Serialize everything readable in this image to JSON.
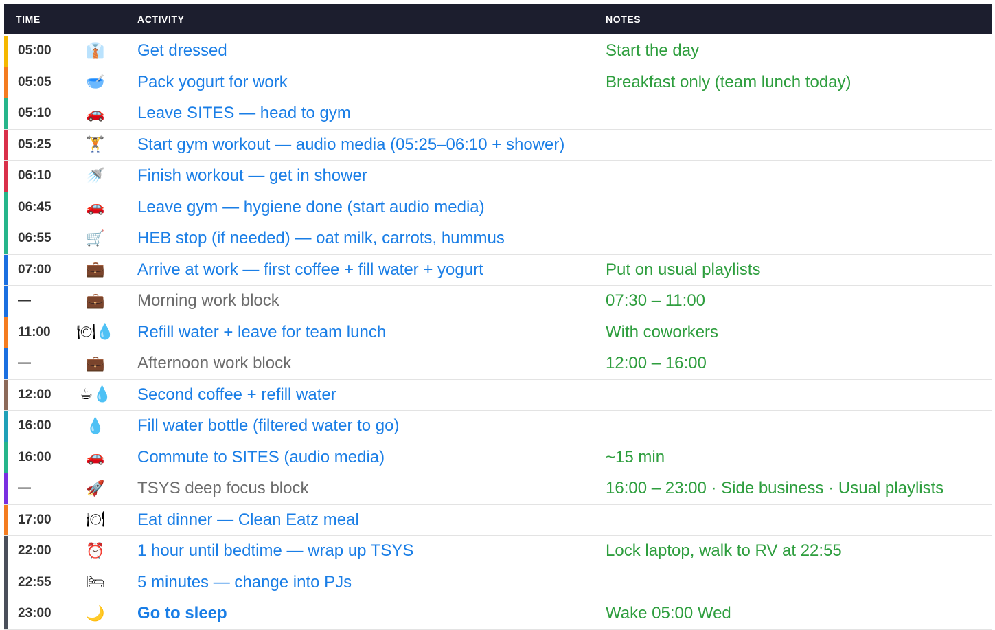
{
  "header": {
    "time": "TIME",
    "activity": "ACTIVITY",
    "notes": "NOTES"
  },
  "rows": [
    {
      "time": "05:00",
      "icon": "👔",
      "icon_name": "shirt-icon",
      "activity": "Get dressed",
      "notes": "Start the day",
      "color": "#f5b800"
    },
    {
      "time": "05:05",
      "icon": "🥣",
      "icon_name": "bowl-icon",
      "activity": "Pack yogurt for work",
      "notes": "Breakfast only (team lunch today)",
      "color": "#f47c20"
    },
    {
      "time": "05:10",
      "icon": "🚗",
      "icon_name": "car-icon",
      "activity": "Leave SITES — head to gym",
      "notes": "",
      "color": "#26b58a"
    },
    {
      "time": "05:25",
      "icon": "🏋",
      "icon_name": "weightlifter-icon",
      "activity": "Start gym workout — audio media (05:25–06:10 + shower)",
      "notes": "",
      "color": "#d9304a"
    },
    {
      "time": "06:10",
      "icon": "🚿",
      "icon_name": "shower-icon",
      "activity": "Finish workout — get in shower",
      "notes": "",
      "color": "#d9304a"
    },
    {
      "time": "06:45",
      "icon": "🚗",
      "icon_name": "car-icon",
      "activity": "Leave gym — hygiene done (start audio media)",
      "notes": "",
      "color": "#26b58a"
    },
    {
      "time": "06:55",
      "icon": "🛒",
      "icon_name": "cart-icon",
      "activity": "HEB stop (if needed) — oat milk, carrots, hummus",
      "notes": "",
      "color": "#26b58a"
    },
    {
      "time": "07:00",
      "icon": "💼",
      "icon_name": "briefcase-icon",
      "activity": "Arrive at work — first coffee + fill water + yogurt",
      "notes": "Put on usual playlists",
      "color": "#1a6fe0"
    },
    {
      "time": "—",
      "icon": "💼",
      "icon_name": "briefcase-icon",
      "activity": "Morning work block",
      "notes": "07:30 – 11:00",
      "color": "#1a6fe0",
      "muted": true
    },
    {
      "time": "11:00",
      "icon": "🍽💧",
      "icon_name": "plate-water-icon",
      "activity": "Refill water + leave for team lunch",
      "notes": "With coworkers",
      "color": "#f47c20"
    },
    {
      "time": "—",
      "icon": "💼",
      "icon_name": "briefcase-icon",
      "activity": "Afternoon work block",
      "notes": "12:00 – 16:00",
      "color": "#1a6fe0",
      "muted": true
    },
    {
      "time": "12:00",
      "icon": "☕💧",
      "icon_name": "coffee-water-icon",
      "activity": "Second coffee + refill water",
      "notes": "",
      "color": "#8c6a5a"
    },
    {
      "time": "16:00",
      "icon": "💧",
      "icon_name": "water-drop-icon",
      "activity": "Fill water bottle (filtered water to go)",
      "notes": "",
      "color": "#1fa0b8"
    },
    {
      "time": "16:00",
      "icon": "🚗",
      "icon_name": "car-icon",
      "activity": "Commute to SITES (audio media)",
      "notes": "~15 min",
      "color": "#26b58a"
    },
    {
      "time": "—",
      "icon": "🚀",
      "icon_name": "rocket-icon",
      "activity": "TSYS deep focus block",
      "notes": "16:00 – 23:00 · Side business · Usual playlists",
      "color": "#7a2fe0",
      "muted": true
    },
    {
      "time": "17:00",
      "icon": "🍽",
      "icon_name": "plate-icon",
      "activity": "Eat dinner — Clean Eatz meal",
      "notes": "",
      "color": "#f47c20"
    },
    {
      "time": "22:00",
      "icon": "⏰",
      "icon_name": "alarm-clock-icon",
      "activity": "1 hour until bedtime — wrap up TSYS",
      "notes": "Lock laptop, walk to RV at 22:55",
      "color": "#4a4f5a"
    },
    {
      "time": "22:55",
      "icon": "🛏",
      "icon_name": "bed-icon",
      "activity": "5 minutes — change into PJs",
      "notes": "",
      "color": "#4a4f5a"
    },
    {
      "time": "23:00",
      "icon": "🌙",
      "icon_name": "moon-icon",
      "activity": "Go to sleep",
      "notes": "Wake 05:00 Wed",
      "color": "#4a4f5a",
      "strong": true
    }
  ]
}
